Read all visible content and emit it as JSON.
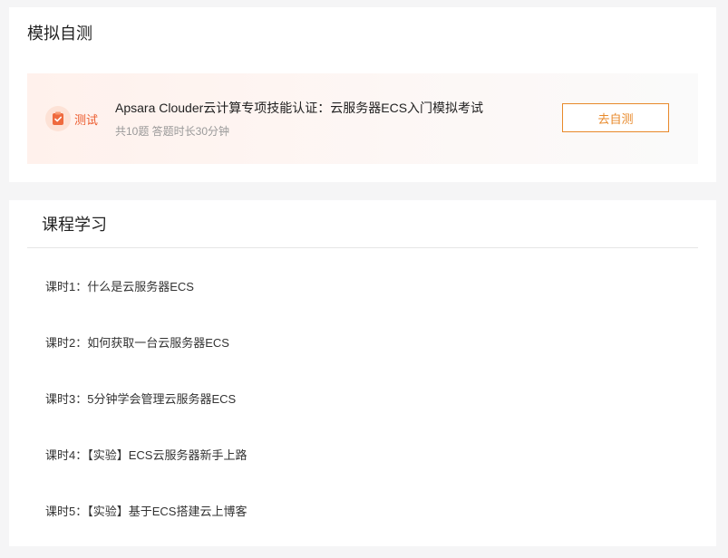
{
  "mock_test": {
    "title": "模拟自测",
    "exam": {
      "badge_label": "测试",
      "badge_icon": "clipboard-check-icon",
      "accent_color": "#ec5b2d",
      "title": "Apsara Clouder云计算专项技能认证：云服务器ECS入门模拟考试",
      "meta": "共10题 答题时长30分钟",
      "action_label": "去自测",
      "action_color": "#e8892a"
    }
  },
  "course": {
    "title": "课程学习",
    "lessons": [
      {
        "label": "课时1：什么是云服务器ECS"
      },
      {
        "label": "课时2：如何获取一台云服务器ECS"
      },
      {
        "label": "课时3：5分钟学会管理云服务器ECS"
      },
      {
        "label": "课时4：【实验】ECS云服务器新手上路"
      },
      {
        "label": "课时5：【实验】基于ECS搭建云上博客"
      }
    ]
  }
}
